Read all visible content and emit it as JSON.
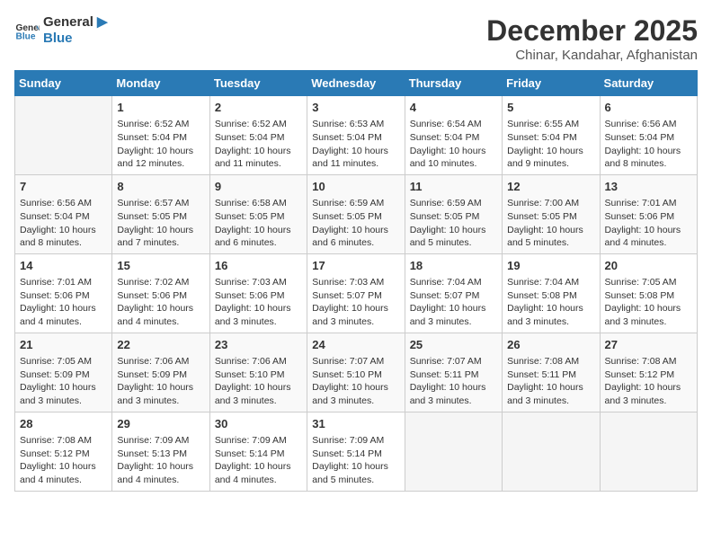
{
  "header": {
    "logo_line1": "General",
    "logo_line2": "Blue",
    "title": "December 2025",
    "subtitle": "Chinar, Kandahar, Afghanistan"
  },
  "weekdays": [
    "Sunday",
    "Monday",
    "Tuesday",
    "Wednesday",
    "Thursday",
    "Friday",
    "Saturday"
  ],
  "weeks": [
    [
      {
        "day": "",
        "info": ""
      },
      {
        "day": "1",
        "info": "Sunrise: 6:52 AM\nSunset: 5:04 PM\nDaylight: 10 hours\nand 12 minutes."
      },
      {
        "day": "2",
        "info": "Sunrise: 6:52 AM\nSunset: 5:04 PM\nDaylight: 10 hours\nand 11 minutes."
      },
      {
        "day": "3",
        "info": "Sunrise: 6:53 AM\nSunset: 5:04 PM\nDaylight: 10 hours\nand 11 minutes."
      },
      {
        "day": "4",
        "info": "Sunrise: 6:54 AM\nSunset: 5:04 PM\nDaylight: 10 hours\nand 10 minutes."
      },
      {
        "day": "5",
        "info": "Sunrise: 6:55 AM\nSunset: 5:04 PM\nDaylight: 10 hours\nand 9 minutes."
      },
      {
        "day": "6",
        "info": "Sunrise: 6:56 AM\nSunset: 5:04 PM\nDaylight: 10 hours\nand 8 minutes."
      }
    ],
    [
      {
        "day": "7",
        "info": "Sunrise: 6:56 AM\nSunset: 5:04 PM\nDaylight: 10 hours\nand 8 minutes."
      },
      {
        "day": "8",
        "info": "Sunrise: 6:57 AM\nSunset: 5:05 PM\nDaylight: 10 hours\nand 7 minutes."
      },
      {
        "day": "9",
        "info": "Sunrise: 6:58 AM\nSunset: 5:05 PM\nDaylight: 10 hours\nand 6 minutes."
      },
      {
        "day": "10",
        "info": "Sunrise: 6:59 AM\nSunset: 5:05 PM\nDaylight: 10 hours\nand 6 minutes."
      },
      {
        "day": "11",
        "info": "Sunrise: 6:59 AM\nSunset: 5:05 PM\nDaylight: 10 hours\nand 5 minutes."
      },
      {
        "day": "12",
        "info": "Sunrise: 7:00 AM\nSunset: 5:05 PM\nDaylight: 10 hours\nand 5 minutes."
      },
      {
        "day": "13",
        "info": "Sunrise: 7:01 AM\nSunset: 5:06 PM\nDaylight: 10 hours\nand 4 minutes."
      }
    ],
    [
      {
        "day": "14",
        "info": "Sunrise: 7:01 AM\nSunset: 5:06 PM\nDaylight: 10 hours\nand 4 minutes."
      },
      {
        "day": "15",
        "info": "Sunrise: 7:02 AM\nSunset: 5:06 PM\nDaylight: 10 hours\nand 4 minutes."
      },
      {
        "day": "16",
        "info": "Sunrise: 7:03 AM\nSunset: 5:06 PM\nDaylight: 10 hours\nand 3 minutes."
      },
      {
        "day": "17",
        "info": "Sunrise: 7:03 AM\nSunset: 5:07 PM\nDaylight: 10 hours\nand 3 minutes."
      },
      {
        "day": "18",
        "info": "Sunrise: 7:04 AM\nSunset: 5:07 PM\nDaylight: 10 hours\nand 3 minutes."
      },
      {
        "day": "19",
        "info": "Sunrise: 7:04 AM\nSunset: 5:08 PM\nDaylight: 10 hours\nand 3 minutes."
      },
      {
        "day": "20",
        "info": "Sunrise: 7:05 AM\nSunset: 5:08 PM\nDaylight: 10 hours\nand 3 minutes."
      }
    ],
    [
      {
        "day": "21",
        "info": "Sunrise: 7:05 AM\nSunset: 5:09 PM\nDaylight: 10 hours\nand 3 minutes."
      },
      {
        "day": "22",
        "info": "Sunrise: 7:06 AM\nSunset: 5:09 PM\nDaylight: 10 hours\nand 3 minutes."
      },
      {
        "day": "23",
        "info": "Sunrise: 7:06 AM\nSunset: 5:10 PM\nDaylight: 10 hours\nand 3 minutes."
      },
      {
        "day": "24",
        "info": "Sunrise: 7:07 AM\nSunset: 5:10 PM\nDaylight: 10 hours\nand 3 minutes."
      },
      {
        "day": "25",
        "info": "Sunrise: 7:07 AM\nSunset: 5:11 PM\nDaylight: 10 hours\nand 3 minutes."
      },
      {
        "day": "26",
        "info": "Sunrise: 7:08 AM\nSunset: 5:11 PM\nDaylight: 10 hours\nand 3 minutes."
      },
      {
        "day": "27",
        "info": "Sunrise: 7:08 AM\nSunset: 5:12 PM\nDaylight: 10 hours\nand 3 minutes."
      }
    ],
    [
      {
        "day": "28",
        "info": "Sunrise: 7:08 AM\nSunset: 5:12 PM\nDaylight: 10 hours\nand 4 minutes."
      },
      {
        "day": "29",
        "info": "Sunrise: 7:09 AM\nSunset: 5:13 PM\nDaylight: 10 hours\nand 4 minutes."
      },
      {
        "day": "30",
        "info": "Sunrise: 7:09 AM\nSunset: 5:14 PM\nDaylight: 10 hours\nand 4 minutes."
      },
      {
        "day": "31",
        "info": "Sunrise: 7:09 AM\nSunset: 5:14 PM\nDaylight: 10 hours\nand 5 minutes."
      },
      {
        "day": "",
        "info": ""
      },
      {
        "day": "",
        "info": ""
      },
      {
        "day": "",
        "info": ""
      }
    ]
  ]
}
